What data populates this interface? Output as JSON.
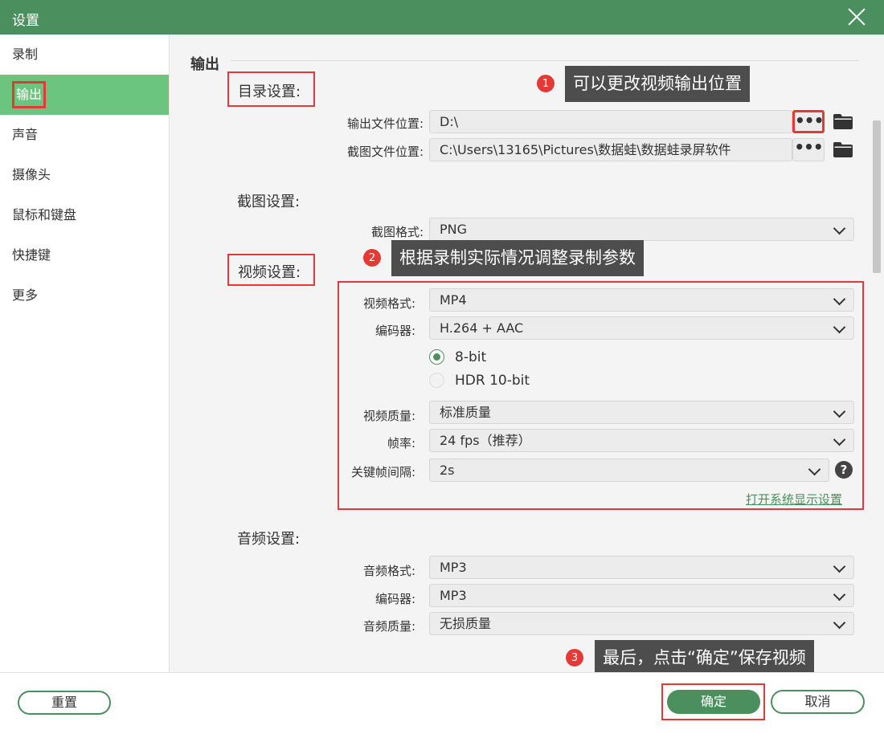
{
  "window": {
    "title": "设置"
  },
  "sidebar": {
    "items": [
      {
        "label": "录制"
      },
      {
        "label": "输出"
      },
      {
        "label": "声音"
      },
      {
        "label": "摄像头"
      },
      {
        "label": "鼠标和键盘"
      },
      {
        "label": "快捷键"
      },
      {
        "label": "更多"
      }
    ],
    "active": "输出"
  },
  "output": {
    "section_title": "输出",
    "directory": {
      "title": "目录设置:",
      "output_location_label": "输出文件位置:",
      "output_location_value": "D:\\",
      "screenshot_location_label": "截图文件位置:",
      "screenshot_location_value": "C:\\Users\\13165\\Pictures\\数据蛙\\数据蛙录屏软件",
      "browse_label": "•••"
    },
    "screenshot": {
      "title": "截图设置:",
      "format_label": "截图格式:",
      "format_value": "PNG"
    },
    "video": {
      "title": "视频设置:",
      "format_label": "视频格式:",
      "format_value": "MP4",
      "encoder_label": "编码器:",
      "encoder_value": "H.264 + AAC",
      "bit_options": [
        {
          "label": "8-bit",
          "selected": true
        },
        {
          "label": "HDR 10-bit",
          "selected": false
        }
      ],
      "quality_label": "视频质量:",
      "quality_value": "标准质量",
      "fps_label": "帧率:",
      "fps_value": "24 fps（推荐）",
      "keyframe_label": "关键帧间隔:",
      "keyframe_value": "2s",
      "help_glyph": "?",
      "display_settings_link": "打开系统显示设置"
    },
    "audio": {
      "title": "音频设置:",
      "format_label": "音频格式:",
      "format_value": "MP3",
      "encoder_label": "编码器:",
      "encoder_value": "MP3",
      "quality_label": "音频质量:",
      "quality_value": "无损质量"
    }
  },
  "annotations": [
    {
      "number": "1",
      "text": "可以更改视频输出位置"
    },
    {
      "number": "2",
      "text": "根据录制实际情况调整录制参数"
    },
    {
      "number": "3",
      "text": "最后，点击“确定”保存视频"
    }
  ],
  "footer": {
    "reset_label": "重置",
    "confirm_label": "确定",
    "cancel_label": "取消"
  },
  "colors": {
    "brand_green": "#4b8f5e",
    "active_nav": "#6cc57e",
    "highlight_red": "#e53935",
    "tooltip_bg": "#4d4d4d"
  },
  "icons": [
    "close-icon",
    "folder-icon",
    "chevron-down-icon",
    "help-icon",
    "radio-icon"
  ]
}
